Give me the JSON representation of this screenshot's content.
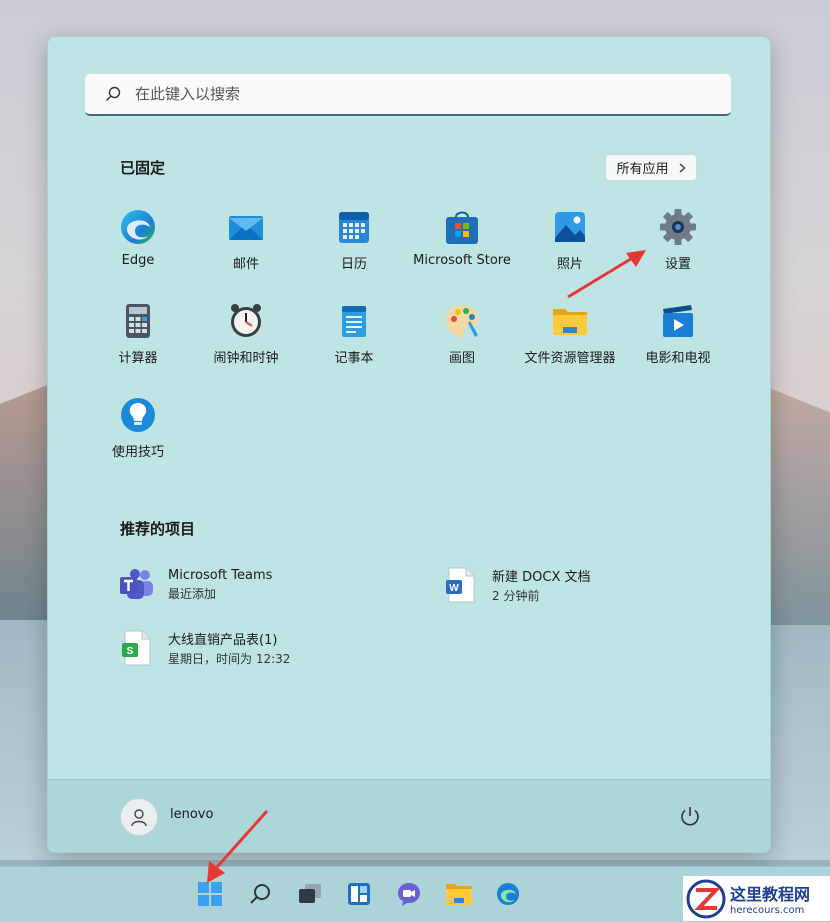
{
  "search": {
    "placeholder": "在此键入以搜索"
  },
  "pinned": {
    "title": "已固定",
    "all_apps_label": "所有应用",
    "apps": [
      {
        "label": "Edge",
        "icon": "edge-icon"
      },
      {
        "label": "邮件",
        "icon": "mail-icon"
      },
      {
        "label": "日历",
        "icon": "calendar-icon"
      },
      {
        "label": "Microsoft Store",
        "icon": "store-icon"
      },
      {
        "label": "照片",
        "icon": "photos-icon"
      },
      {
        "label": "设置",
        "icon": "settings-icon"
      },
      {
        "label": "计算器",
        "icon": "calculator-icon"
      },
      {
        "label": "闹钟和时钟",
        "icon": "clock-icon"
      },
      {
        "label": "记事本",
        "icon": "notepad-icon"
      },
      {
        "label": "画图",
        "icon": "paint-icon"
      },
      {
        "label": "文件资源管理器",
        "icon": "file-explorer-icon"
      },
      {
        "label": "电影和电视",
        "icon": "movies-tv-icon"
      },
      {
        "label": "使用技巧",
        "icon": "tips-icon"
      }
    ]
  },
  "recommended": {
    "title": "推荐的项目",
    "items": [
      {
        "name": "Microsoft Teams",
        "detail": "最近添加",
        "icon": "teams-icon"
      },
      {
        "name": "新建 DOCX 文档",
        "detail": "2 分钟前",
        "icon": "word-doc-icon"
      },
      {
        "name": "大线直销产品表(1)",
        "detail": "星期日，时间为 12:32",
        "icon": "spreadsheet-icon"
      }
    ]
  },
  "user": {
    "name": "lenovo"
  },
  "watermark": {
    "title": "这里教程网",
    "url": "herecours.com"
  },
  "colors": {
    "panel": "#bfe4e4",
    "accent": "#0078d4",
    "arrow": "#e53935"
  }
}
